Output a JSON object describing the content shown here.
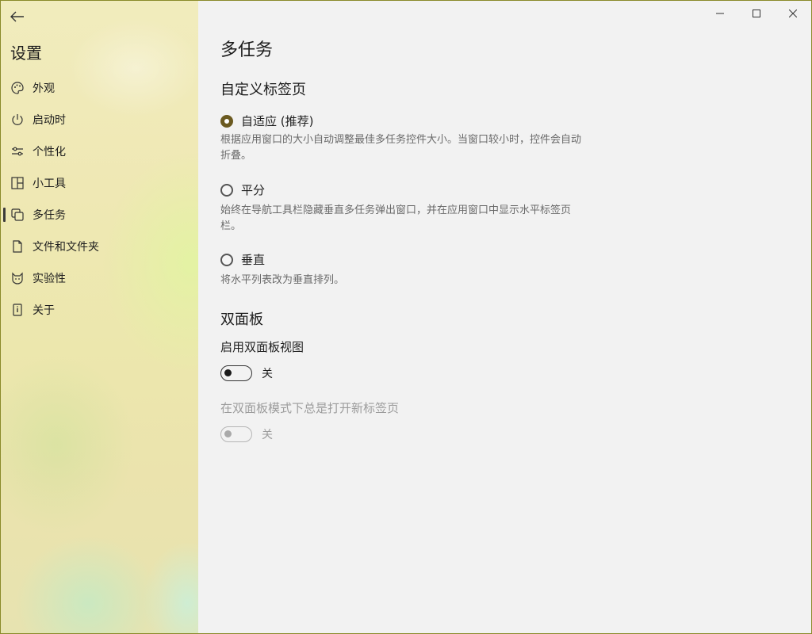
{
  "sidebar": {
    "title": "设置",
    "items": [
      {
        "label": "外观",
        "icon": "palette-icon",
        "active": false
      },
      {
        "label": "启动时",
        "icon": "power-icon",
        "active": false
      },
      {
        "label": "个性化",
        "icon": "sliders-icon",
        "active": false
      },
      {
        "label": "小工具",
        "icon": "widgets-icon",
        "active": false
      },
      {
        "label": "多任务",
        "icon": "multitask-icon",
        "active": true
      },
      {
        "label": "文件和文件夹",
        "icon": "file-icon",
        "active": false
      },
      {
        "label": "实验性",
        "icon": "cat-icon",
        "active": false
      },
      {
        "label": "关于",
        "icon": "info-icon",
        "active": false
      }
    ]
  },
  "page": {
    "title": "多任务",
    "tabs_section": {
      "heading": "自定义标签页",
      "options": [
        {
          "label": "自适应 (推荐)",
          "checked": true,
          "desc": "根据应用窗口的大小自动调整最佳多任务控件大小。当窗口较小时，控件会自动折叠。"
        },
        {
          "label": "平分",
          "checked": false,
          "desc": "始终在导航工具栏隐藏垂直多任务弹出窗口，并在应用窗口中显示水平标签页栏。"
        },
        {
          "label": "垂直",
          "checked": false,
          "desc": "将水平列表改为垂直排列。"
        }
      ]
    },
    "dual_pane": {
      "heading": "双面板",
      "enable_label": "启用双面板视图",
      "enable_state": "关",
      "new_tab_label": "在双面板模式下总是打开新标签页",
      "new_tab_state": "关"
    }
  },
  "colors": {
    "accent": "#6b5a20"
  }
}
